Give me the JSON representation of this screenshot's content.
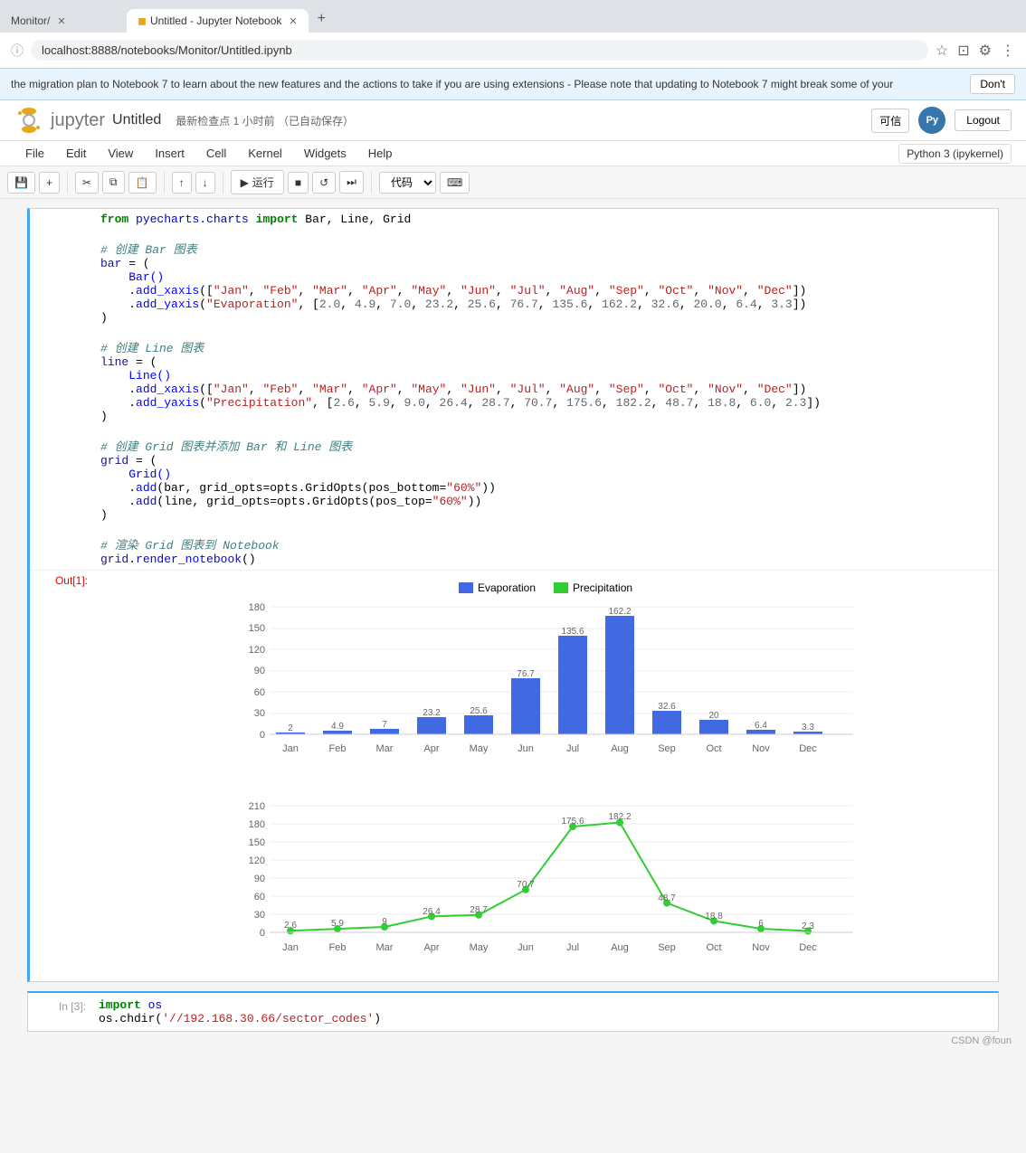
{
  "browser": {
    "tabs": [
      {
        "label": "Monitor/",
        "active": false
      },
      {
        "label": "Untitled - Jupyter Notebook",
        "active": true
      }
    ],
    "url": "localhost:8888/notebooks/Monitor/Untitled.ipynb"
  },
  "notification": {
    "text": "the migration plan to Notebook 7 to learn about the new features and the actions to take if you are using extensions - Please note that updating to Notebook 7 might break some of your",
    "button": "Don't"
  },
  "jupyter": {
    "logo": "jupyter",
    "title": "Untitled",
    "checkpoint": "最新检查点 1 小时前 （已自动保存）",
    "trusted": "可信",
    "kernel": "Python 3 (ipykernel)",
    "logout": "Logout"
  },
  "menu": {
    "items": [
      "File",
      "Edit",
      "View",
      "Insert",
      "Cell",
      "Kernel",
      "Widgets",
      "Help"
    ]
  },
  "toolbar": {
    "run_label": "运行",
    "cell_type": "代码"
  },
  "code": {
    "line1": "from pyecharts.charts import Bar, Line, Grid",
    "comment1": "# 创建 Bar 图表",
    "bar_lines": [
      "bar = (",
      "    Bar()",
      "    .add_xaxis([\"Jan\", \"Feb\", \"Mar\", \"Apr\", \"May\", \"Jun\", \"Jul\", \"Aug\", \"Sep\", \"Oct\", \"Nov\", \"Dec\"])",
      "    .add_yaxis(\"Evaporation\", [2.0, 4.9, 7.0, 23.2, 25.6, 76.7, 135.6, 162.2, 32.6, 20.0, 6.4, 3.3])",
      ")"
    ],
    "comment2": "# 创建 Line 图表",
    "line_lines": [
      "line = (",
      "    Line()",
      "    .add_xaxis([\"Jan\", \"Feb\", \"Mar\", \"Apr\", \"May\", \"Jun\", \"Jul\", \"Aug\", \"Sep\", \"Oct\", \"Nov\", \"Dec\"])",
      "    .add_yaxis(\"Precipitation\", [2.6, 5.9, 9.0, 26.4, 28.7, 70.7, 175.6, 182.2, 48.7, 18.8, 6.0, 2.3])",
      ")"
    ],
    "comment3": "# 创建 Grid 图表并添加 Bar 和 Line 图表",
    "grid_lines": [
      "grid = (",
      "    Grid()",
      "    .add(bar, grid_opts=opts.GridOpts(pos_bottom=\"60%\"))",
      "    .add(line, grid_opts=opts.GridOpts(pos_top=\"60%\"))",
      ")"
    ],
    "comment4": "# 渲染 Grid 图表到 Notebook",
    "render_line": "grid.render_notebook()"
  },
  "output_label": "Out[1]:",
  "chart": {
    "bar": {
      "title": "Evaporation",
      "months": [
        "Jan",
        "Feb",
        "Mar",
        "Apr",
        "May",
        "Jun",
        "Jul",
        "Aug",
        "Sep",
        "Oct",
        "Nov",
        "Dec"
      ],
      "values": [
        2.0,
        4.9,
        7.0,
        23.2,
        25.6,
        76.7,
        135.6,
        162.2,
        32.6,
        20.0,
        6.4,
        3.3
      ],
      "color": "#4169E1",
      "y_labels": [
        "0",
        "30",
        "60",
        "90",
        "120",
        "150",
        "180"
      ]
    },
    "line": {
      "title": "Precipitation",
      "months": [
        "Jan",
        "Feb",
        "Mar",
        "Apr",
        "May",
        "Jun",
        "Jul",
        "Aug",
        "Sep",
        "Oct",
        "Nov",
        "Dec"
      ],
      "values": [
        2.6,
        5.9,
        9.0,
        26.4,
        28.7,
        70.7,
        175.6,
        182.2,
        48.7,
        18.8,
        6.0,
        2.3
      ],
      "color": "#32CD32",
      "y_labels": [
        "0",
        "30",
        "60",
        "90",
        "120",
        "150",
        "180",
        "210"
      ]
    }
  },
  "bottom_cell": {
    "in_label": "In [3]:",
    "code_line1": "import os",
    "code_line2": "os.chdir('//192.168.30.66/sector_codes')"
  },
  "footer": {
    "text": "CSDN @foun"
  }
}
